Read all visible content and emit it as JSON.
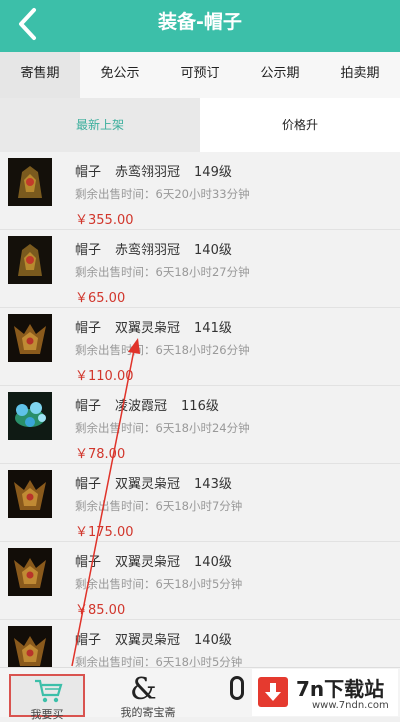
{
  "header": {
    "title": "装备-帽子"
  },
  "tabs": [
    {
      "label": "寄售期",
      "active": true
    },
    {
      "label": "免公示",
      "active": false
    },
    {
      "label": "可预订",
      "active": false
    },
    {
      "label": "公示期",
      "active": false
    },
    {
      "label": "拍卖期",
      "active": false
    }
  ],
  "subtabs": [
    {
      "label": "最新上架",
      "active": true
    },
    {
      "label": "价格升",
      "active": false
    }
  ],
  "items": [
    {
      "category": "帽子",
      "item": "赤鸾翎羽冠",
      "level": "149级",
      "remain": "剩余出售时间：6天20小时33分钟",
      "price": "￥355.00",
      "icon": "red-crown-helmet-icon"
    },
    {
      "category": "帽子",
      "item": "赤鸾翎羽冠",
      "level": "140级",
      "remain": "剩余出售时间：6天18小时27分钟",
      "price": "￥65.00",
      "icon": "red-crown-helmet-icon"
    },
    {
      "category": "帽子",
      "item": "双翼灵枭冠",
      "level": "141级",
      "remain": "剩余出售时间：6天18小时26分钟",
      "price": "￥110.00",
      "icon": "winged-owl-helmet-icon"
    },
    {
      "category": "帽子",
      "item": "凌波霞冠",
      "level": "116级",
      "remain": "剩余出售时间：6天18小时24分钟",
      "price": "￥78.00",
      "icon": "blue-flower-crown-icon"
    },
    {
      "category": "帽子",
      "item": "双翼灵枭冠",
      "level": "143级",
      "remain": "剩余出售时间：6天18小时7分钟",
      "price": "￥175.00",
      "icon": "winged-owl-helmet-icon"
    },
    {
      "category": "帽子",
      "item": "双翼灵枭冠",
      "level": "140级",
      "remain": "剩余出售时间：6天18小时5分钟",
      "price": "￥85.00",
      "icon": "winged-owl-helmet-icon"
    },
    {
      "category": "帽子",
      "item": "双翼灵枭冠",
      "level": "140级",
      "remain": "剩余出售时间：6天18小时5分钟",
      "price": "",
      "icon": "winged-owl-helmet-icon"
    }
  ],
  "bottom_nav": [
    {
      "label": "我要买",
      "icon": "shopping-cart-icon"
    },
    {
      "label": "我的寄宝斋",
      "icon": "ampersand-icon"
    }
  ],
  "watermark": {
    "title": "7n下载站",
    "url": "www.7ndn.com"
  },
  "colors": {
    "header": "#3cbfa9",
    "price": "#d1362c",
    "highlight": "#d9534f",
    "active_subtab": "#3caf9d"
  }
}
